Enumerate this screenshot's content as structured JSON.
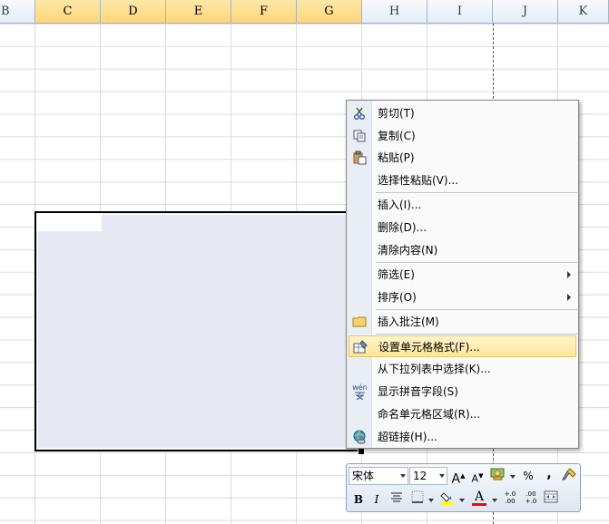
{
  "columns": [
    "B",
    "C",
    "D",
    "E",
    "F",
    "G",
    "H",
    "I",
    "J",
    "K"
  ],
  "selected_columns": [
    "C",
    "D",
    "E",
    "F",
    "G"
  ],
  "context_menu": {
    "items": [
      {
        "label": "剪切(T)",
        "icon": "scissors-icon"
      },
      {
        "label": "复制(C)",
        "icon": "copy-icon"
      },
      {
        "label": "粘贴(P)",
        "icon": "paste-icon"
      },
      {
        "label": "选择性粘贴(V)...",
        "icon": ""
      },
      {
        "label": "插入(I)...",
        "icon": ""
      },
      {
        "label": "删除(D)...",
        "icon": ""
      },
      {
        "label": "清除内容(N)",
        "icon": ""
      },
      {
        "label": "筛选(E)",
        "icon": "",
        "submenu": true
      },
      {
        "label": "排序(O)",
        "icon": "",
        "submenu": true
      },
      {
        "label": "插入批注(M)",
        "icon": "comment-icon"
      },
      {
        "label": "设置单元格格式(F)...",
        "icon": "format-cells-icon",
        "highlighted": true
      },
      {
        "label": "从下拉列表中选择(K)...",
        "icon": ""
      },
      {
        "label": "显示拼音字段(S)",
        "icon": "phonetic-icon",
        "icon_text": "wén"
      },
      {
        "label": "命名单元格区域(R)...",
        "icon": ""
      },
      {
        "label": "超链接(H)...",
        "icon": "hyperlink-icon"
      }
    ]
  },
  "mini_toolbar": {
    "font_name": "宋体",
    "font_size": "12",
    "grow_font": "A",
    "shrink_font": "A",
    "percent": "%",
    "comma": ",",
    "bold": "B",
    "italic": "I",
    "font_color_letter": "A",
    "increase_decimal": "+.0 .00",
    "decrease_decimal": ".00 +.0",
    "colors": {
      "highlight": "#ffff00",
      "font_color": "#ff0000"
    }
  }
}
